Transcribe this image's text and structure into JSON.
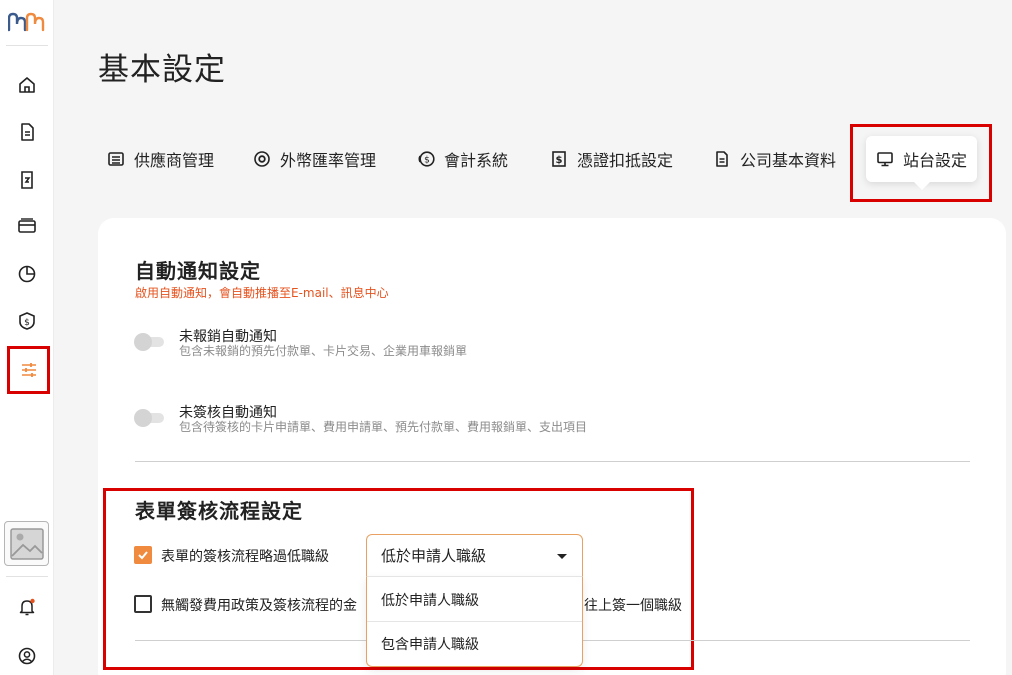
{
  "page": {
    "title": "基本設定"
  },
  "tabs": [
    {
      "label": "供應商管理",
      "icon": "vendor-icon"
    },
    {
      "label": "外幣匯率管理",
      "icon": "target-icon"
    },
    {
      "label": "會計系統",
      "icon": "coin-icon"
    },
    {
      "label": "憑證扣抵設定",
      "icon": "dollar-doc-icon"
    },
    {
      "label": "公司基本資料",
      "icon": "document-icon"
    },
    {
      "label": "站台設定",
      "icon": "monitor-icon",
      "active": true
    }
  ],
  "auto_notify": {
    "title": "自動通知設定",
    "subtitle": "啟用自動通知，會自動推播至E-mail、訊息中心",
    "options": [
      {
        "label": "未報銷自動通知",
        "desc": "包含未報銷的預先付款單、卡片交易、企業用車報銷單",
        "enabled": false
      },
      {
        "label": "未簽核自動通知",
        "desc": "包含待簽核的卡片申請單、費用申請單、預先付款單、費用報銷單、支出項目",
        "enabled": false
      }
    ]
  },
  "approval_flow": {
    "title": "表單簽核流程設定",
    "rule1": {
      "label": "表單的簽核流程略過低職級",
      "checked": true
    },
    "rule2": {
      "label_before": "無觸發費用政策及簽核流程的金",
      "label_after": "往上簽一個職級",
      "checked": false
    },
    "select": {
      "value": "低於申請人職級",
      "options": [
        "低於申請人職級",
        "包含申請人職級"
      ]
    }
  },
  "colors": {
    "accent": "#ef8a3e",
    "annotation": "#d90000",
    "warning_text": "#e5531f"
  }
}
